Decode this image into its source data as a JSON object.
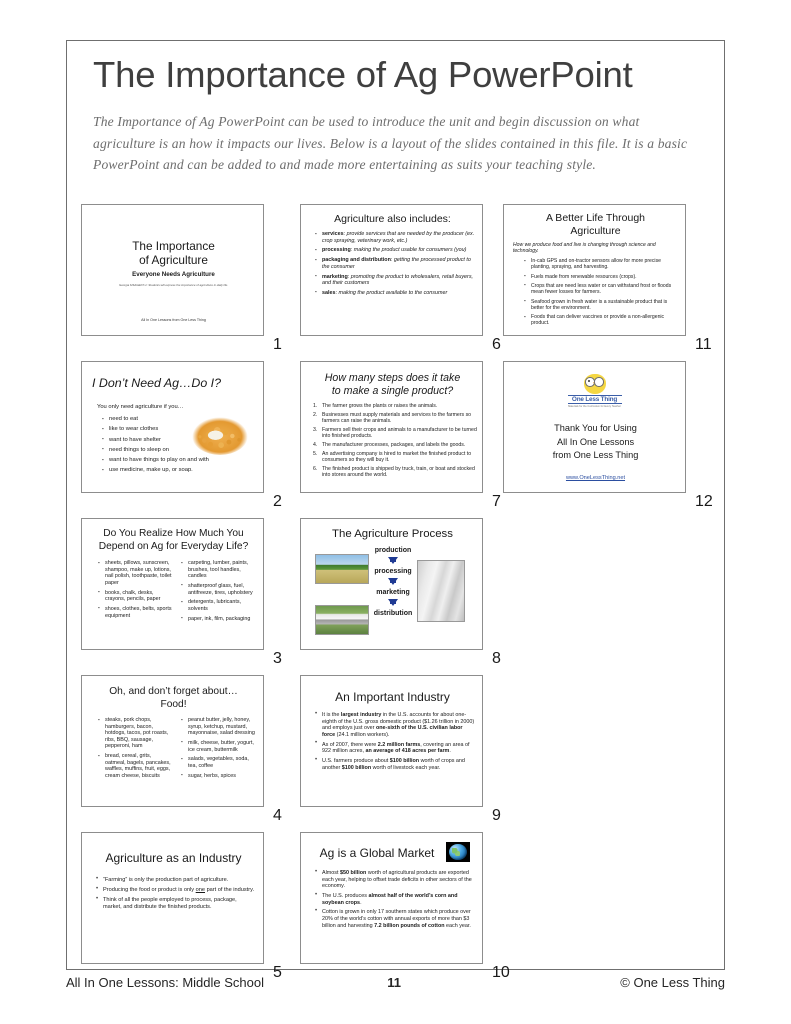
{
  "header": {
    "title": "The Importance of Ag PowerPoint",
    "intro": "The Importance of Ag PowerPoint can be used to introduce the unit and begin discussion on what agriculture is an how it impacts our lives. Below is a layout of the slides contained in this file. It is a basic PowerPoint and can be added to and made more entertaining as suits your teaching style."
  },
  "footer": {
    "left": "All In One Lessons: Middle School",
    "page": "11",
    "right": "© One Less Thing"
  },
  "slides": {
    "s1": {
      "number": "1",
      "title_line1": "The Importance",
      "title_line2": "of Agriculture",
      "subtitle": "Everyone Needs Agriculture",
      "standard": "Georgia MSAGED7-1: Students will express the importance of agriculture in daily life.",
      "footer": "All In One Lessons from One Less Thing"
    },
    "s2": {
      "number": "2",
      "title": "I Don’t Need Ag…Do I?",
      "lead": "You only need agriculture if you…",
      "items": [
        "need to eat",
        "like to wear clothes",
        "want to have shelter",
        "need things to sleep on",
        "want to have things to play on and with",
        "use medicine, make up, or soap."
      ],
      "image": "corn-bowl-image"
    },
    "s3": {
      "number": "3",
      "title_line1": "Do You Realize How Much You",
      "title_line2": "Depend on Ag for Everyday Life?",
      "col1": [
        "sheets, pillows, sunscreen, shampoo, make up, lotions, nail polish, toothpaste, toilet paper",
        "books, chalk, desks, crayons, pencils, paper",
        "shoes, clothes, belts, sports equipment"
      ],
      "col2": [
        "carpeting, lumber, paints, brushes, tool handles, candles",
        "shatterproof glass, fuel, antifreeze, tires, upholstery",
        "detergents, lubricants, solvents",
        "paper, ink, film, packaging"
      ]
    },
    "s4": {
      "number": "4",
      "title_line1": "Oh, and don’t forget about…",
      "title_line2": "Food!",
      "col1": [
        "steaks, pork chops, hamburgers, bacon, hotdogs, tacos, pot roasts, ribs, BBQ, sausage, pepperoni, ham",
        "bread, cereal, grits, oatmeal, bagels, pancakes, waffles, muffins, fruit, eggs, cream cheese, biscuits"
      ],
      "col2": [
        "peanut butter, jelly, honey, syrup, ketchup, mustard, mayonnaise, salad dressing",
        "milk, cheese, butter, yogurt, ice cream, buttermilk",
        "salads, vegetables, soda, tea, coffee",
        "sugar, herbs, spices"
      ]
    },
    "s5": {
      "number": "5",
      "title": "Agriculture as an Industry",
      "items": [
        "“Farming” is only the production part of agriculture.",
        "Producing the food or product is only <u>one</u> part of the industry.",
        "Think of all the people employed to process, package, market, and distribute the finished products."
      ]
    },
    "s6": {
      "number": "6",
      "title": "Agriculture also includes:",
      "items": [
        "<b>services</b>: <em>provide services that are needed by the producer (ex. crop spraying, veterinary work, etc.)</em>",
        "<b>processing</b>: <em>making the product usable for consumers (you)</em>",
        "<b>packaging and distribution</b>: <em>getting the processed product to the consumer</em>",
        "<b>marketing</b>: <em>promoting the product to wholesalers, retail buyers, and their customers</em>",
        "<b>sales</b>: <em>making the product available to the consumer</em>"
      ]
    },
    "s7": {
      "number": "7",
      "title_line1": "How many steps does it take",
      "title_line2": "to make a single product?",
      "items": [
        "The farmer grows the plants or raises the animals.",
        "Businesses must supply materials and services to the farmers so farmers can raise the animals.",
        "Farmers sell their crops and animals to a manufacturer to be turned into finished products.",
        "The manufacturer processes, packages, and labels the goods.",
        "An advertising company is hired to market the finished product to consumers so they will buy it.",
        "The finished product is shipped by truck, train, or boat and stocked into stores around the world."
      ]
    },
    "s8": {
      "number": "8",
      "title": "The Agriculture Process",
      "steps": [
        "production",
        "processing",
        "marketing",
        "distribution"
      ],
      "arrow_color": "#1f3a93",
      "images": [
        "combine-harvester-photo",
        "grain-silo-photo",
        "truck-highway-photo"
      ]
    },
    "s9": {
      "number": "9",
      "title": "An Important Industry",
      "items": [
        "It is the <b>largest industry</b> in the U.S. accounts for about one-eighth of the U.S. gross domestic product ($1.26 trillion in 2000) and employs just over <b>one-sixth of the U.S. civilian labor force</b> (24.1 million workers).",
        "As of 2007, there were <b>2.2 million farms</b>, covering an area of 922 million acres, <b>an average of 418 acres per farm</b>.",
        "U.S. farmers produce about <b>$100 billion</b> worth of crops and another <b>$100 billion</b> worth of livestock each year."
      ]
    },
    "s10": {
      "number": "10",
      "title": "Ag is a Global Market",
      "icon": "globe-icon",
      "items": [
        "Almost <b>$50 billion</b> worth of agricultural products are exported each year, helping to offset trade deficits in other sectors of the economy.",
        "The U.S. produces <b>almost half of the world’s corn and soybean crops</b>.",
        "Cotton is grown in only 17 southern states which produce over 20% of the world’s cotton with annual exports of more than $3 billion and harvesting <b>7.2 billion pounds of cotton</b> each year."
      ]
    },
    "s11": {
      "number": "11",
      "title_line1": "A Better Life Through",
      "title_line2": "Agriculture",
      "lead": "How we produce food and live is changing through science and technology.",
      "items": [
        "In-cab GPS and on-tractor sensors allow for more precise planting, spraying, and harvesting.",
        "Fuels made from renewable resources (crops).",
        "Crops that are need less water or can withstand frost or floods mean fewer losses for farmers.",
        "Seafood grown in fresh water is a sustainable product that is better for the environment.",
        "Foods that can deliver vaccines or provide a non-allergenic product."
      ]
    },
    "s12": {
      "number": "12",
      "logo_word": "One Less Thing",
      "logo_tag": "Materials for the Curriculum for Every Teacher",
      "thanks_line1": "Thank You for Using",
      "thanks_line2": "All In One Lessons",
      "thanks_line3": "from One Less Thing",
      "url": "www.OneLessThing.net"
    }
  }
}
